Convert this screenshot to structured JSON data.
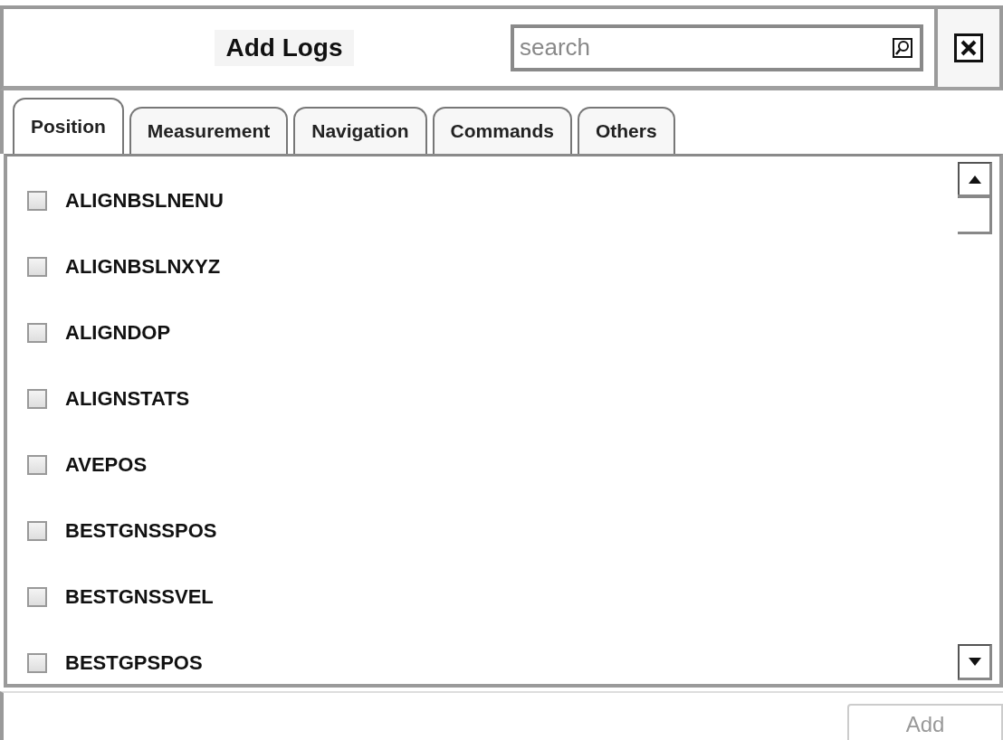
{
  "window": {
    "title": "Add Logs"
  },
  "search": {
    "placeholder": "search"
  },
  "tabs": [
    {
      "label": "Position",
      "selected": true
    },
    {
      "label": "Measurement",
      "selected": false
    },
    {
      "label": "Navigation",
      "selected": false
    },
    {
      "label": "Commands",
      "selected": false
    },
    {
      "label": "Others",
      "selected": false
    }
  ],
  "logs": [
    {
      "name": "ALIGNBSLNENU",
      "checked": false
    },
    {
      "name": "ALIGNBSLNXYZ",
      "checked": false
    },
    {
      "name": "ALIGNDOP",
      "checked": false
    },
    {
      "name": "ALIGNSTATS",
      "checked": false
    },
    {
      "name": "AVEPOS",
      "checked": false
    },
    {
      "name": "BESTGNSSPOS",
      "checked": false
    },
    {
      "name": "BESTGNSSVEL",
      "checked": false
    },
    {
      "name": "BESTGPSPOS",
      "checked": false
    }
  ],
  "add_button": {
    "label": "Add",
    "disabled": true
  }
}
